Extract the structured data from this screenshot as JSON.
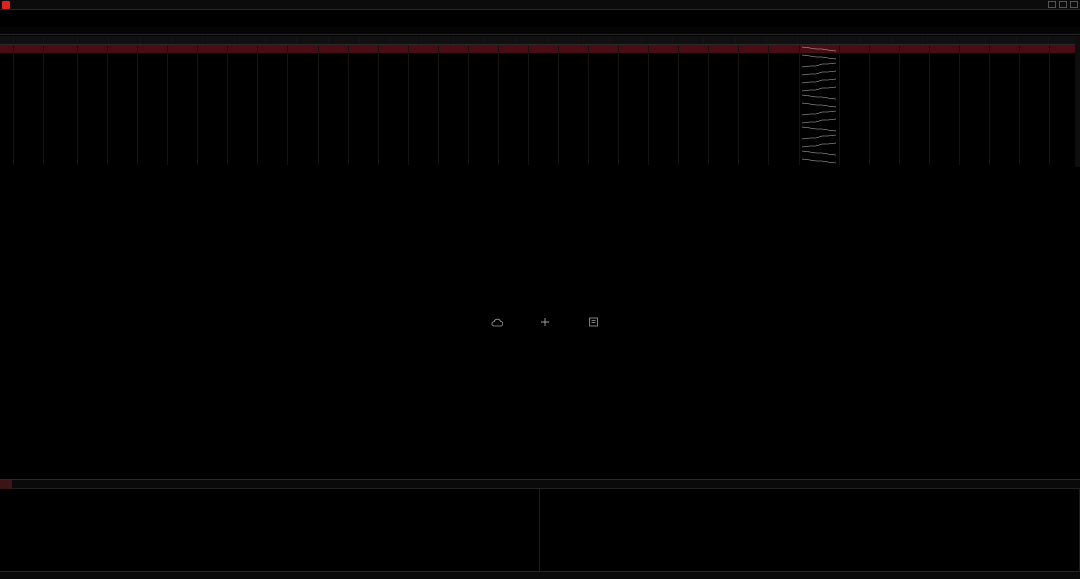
{
  "window": {
    "title": ""
  },
  "menus": {
    "top": [
      "",
      "",
      "",
      "",
      "",
      "",
      "",
      "",
      "",
      "",
      "",
      "",
      ""
    ],
    "function": [
      "",
      "",
      "",
      "",
      "",
      "",
      "",
      "",
      "",
      "",
      "",
      "",
      "",
      "",
      "",
      "",
      "",
      "",
      ""
    ],
    "quick": [
      "",
      "",
      "",
      "",
      "",
      "",
      "",
      "",
      "",
      "",
      "",
      "",
      "",
      "",
      "",
      "",
      "",
      "",
      "",
      ""
    ],
    "tabs": [
      "",
      "",
      "",
      "",
      "",
      "",
      "",
      "",
      "",
      "",
      "",
      "",
      "",
      "",
      "",
      "",
      "",
      "",
      ""
    ]
  },
  "table": {
    "headers": [
      "",
      "",
      "",
      "",
      "",
      "",
      "",
      "",
      "",
      "",
      "",
      "",
      "",
      "",
      "",
      "",
      "",
      "",
      "",
      "",
      "",
      "",
      "",
      "",
      "",
      "",
      "",
      "",
      "",
      "",
      "",
      "",
      "",
      "",
      ""
    ],
    "selected_row": 0,
    "rows": [
      {
        "idx": "",
        "code": "",
        "name": "",
        "dir": "down",
        "cells": [
          "",
          "",
          "",
          "",
          "",
          "",
          "",
          "",
          "",
          "",
          "",
          "",
          "",
          "",
          "",
          "",
          "",
          "",
          "",
          "",
          "",
          "",
          "",
          "",
          "",
          "",
          "",
          "",
          "",
          "",
          "",
          ""
        ]
      },
      {
        "idx": "",
        "code": "",
        "name": "",
        "dir": "down",
        "cells": [
          "",
          "",
          "",
          "",
          "",
          "",
          "",
          "",
          "",
          "",
          "",
          "",
          "",
          "",
          "",
          "",
          "",
          "",
          "",
          "",
          "",
          "",
          "",
          "",
          "",
          "",
          "",
          "",
          "",
          "",
          "",
          ""
        ]
      },
      {
        "idx": "",
        "code": "",
        "name": "",
        "dir": "up",
        "cells": [
          "",
          "",
          "",
          "",
          "",
          "",
          "",
          "",
          "",
          "",
          "",
          "",
          "",
          "",
          "",
          "",
          "",
          "",
          "",
          "",
          "",
          "",
          "",
          "",
          "",
          "",
          "",
          "",
          "",
          "",
          "",
          ""
        ]
      },
      {
        "idx": "",
        "code": "",
        "name": "",
        "dir": "up",
        "cells": [
          "",
          "",
          "",
          "",
          "",
          "",
          "",
          "",
          "",
          "",
          "",
          "",
          "",
          "",
          "",
          "",
          "",
          "",
          "",
          "",
          "",
          "",
          "",
          "",
          "",
          "",
          "",
          "",
          "",
          "",
          "",
          ""
        ]
      },
      {
        "idx": "",
        "code": "",
        "name": "",
        "dir": "up",
        "cells": [
          "",
          "",
          "",
          "",
          "",
          "",
          "",
          "",
          "",
          "",
          "",
          "",
          "",
          "",
          "",
          "",
          "",
          "",
          "",
          "",
          "",
          "",
          "",
          "",
          "",
          "",
          "",
          "",
          "",
          "",
          "",
          ""
        ]
      },
      {
        "idx": "",
        "code": "",
        "name": "",
        "dir": "up",
        "cells": [
          "",
          "",
          "",
          "",
          "",
          "",
          "",
          "",
          "",
          "",
          "",
          "",
          "",
          "",
          "",
          "",
          "",
          "",
          "",
          "",
          "",
          "",
          "",
          "",
          "",
          "",
          "",
          "",
          "",
          "",
          "",
          ""
        ]
      },
      {
        "idx": "",
        "code": "",
        "name": "",
        "dir": "down",
        "cells": [
          "",
          "",
          "",
          "",
          "",
          "",
          "",
          "",
          "",
          "",
          "",
          "",
          "",
          "",
          "",
          "",
          "",
          "",
          "",
          "",
          "",
          "",
          "",
          "",
          "",
          "",
          "",
          "",
          "",
          "",
          "",
          ""
        ]
      },
      {
        "idx": "",
        "code": "",
        "name": "",
        "dir": "down",
        "cells": [
          "",
          "",
          "",
          "",
          "",
          "",
          "",
          "",
          "",
          "",
          "",
          "",
          "",
          "",
          "",
          "",
          "",
          "",
          "",
          "",
          "",
          "",
          "",
          "",
          "",
          "",
          "",
          "",
          "",
          "",
          "",
          ""
        ]
      },
      {
        "idx": "",
        "code": "",
        "name": "",
        "dir": "up",
        "cells": [
          "",
          "",
          "",
          "",
          "",
          "",
          "",
          "",
          "",
          "",
          "",
          "",
          "",
          "",
          "",
          "",
          "",
          "",
          "",
          "",
          "",
          "",
          "",
          "",
          "",
          "",
          "",
          "",
          "",
          "",
          "",
          ""
        ]
      },
      {
        "idx": "",
        "code": "",
        "name": "",
        "dir": "up",
        "cells": [
          "",
          "",
          "",
          "",
          "",
          "",
          "",
          "",
          "",
          "",
          "",
          "",
          "",
          "",
          "",
          "",
          "",
          "",
          "",
          "",
          "",
          "",
          "",
          "",
          "",
          "",
          "",
          "",
          "",
          "",
          "",
          ""
        ]
      },
      {
        "idx": "",
        "code": "",
        "name": "",
        "dir": "down",
        "cells": [
          "",
          "",
          "",
          "",
          "",
          "",
          "",
          "",
          "",
          "",
          "",
          "",
          "",
          "",
          "",
          "",
          "",
          "",
          "",
          "",
          "",
          "",
          "",
          "",
          "",
          "",
          "",
          "",
          "",
          "",
          "",
          ""
        ]
      },
      {
        "idx": "",
        "code": "",
        "name": "",
        "dir": "up",
        "cells": [
          "",
          "",
          "",
          "",
          "",
          "",
          "",
          "",
          "",
          "",
          "",
          "",
          "",
          "",
          "",
          "",
          "",
          "",
          "",
          "",
          "",
          "",
          "",
          "",
          "",
          "",
          "",
          "",
          "",
          "",
          "",
          ""
        ]
      },
      {
        "idx": "",
        "code": "",
        "name": "",
        "dir": "up",
        "cells": [
          "",
          "",
          "",
          "",
          "",
          "",
          "",
          "",
          "",
          "",
          "",
          "",
          "",
          "",
          "",
          "",
          "",
          "",
          "",
          "",
          "",
          "",
          "",
          "",
          "",
          "",
          "",
          "",
          "",
          "",
          "",
          ""
        ]
      },
      {
        "idx": "",
        "code": "",
        "name": "",
        "dir": "down",
        "cells": [
          "",
          "",
          "",
          "",
          "",
          "",
          "",
          "",
          "",
          "",
          "",
          "",
          "",
          "",
          "",
          "",
          "",
          "",
          "",
          "",
          "",
          "",
          "",
          "",
          "",
          "",
          "",
          "",
          "",
          "",
          "",
          ""
        ]
      },
      {
        "idx": "",
        "code": "",
        "name": "",
        "dir": "down",
        "cells": [
          "",
          "",
          "",
          "",
          "",
          "",
          "",
          "",
          "",
          "",
          "",
          "",
          "",
          "",
          "",
          "",
          "",
          "",
          "",
          "",
          "",
          "",
          "",
          "",
          "",
          "",
          "",
          "",
          "",
          "",
          "",
          ""
        ]
      }
    ]
  },
  "empty_actions": [
    {
      "name": "cloud-sync",
      "icon": "cloud-icon",
      "label": ""
    },
    {
      "name": "add",
      "icon": "plus-icon",
      "label": ""
    },
    {
      "name": "help",
      "icon": "book-icon",
      "label": ""
    }
  ],
  "news": {
    "tabs": [
      "",
      "",
      "",
      ""
    ],
    "active_tab": 0,
    "left": [
      {
        "text": "",
        "time": ""
      },
      {
        "text": "",
        "time": ""
      },
      {
        "text": "",
        "time": ""
      },
      {
        "text": "",
        "time": ""
      },
      {
        "text": "",
        "time": ""
      },
      {
        "text": "",
        "time": ""
      },
      {
        "text": "",
        "time": ""
      },
      {
        "text": "",
        "time": ""
      },
      {
        "text": "",
        "time": ""
      },
      {
        "text": "",
        "time": ""
      }
    ],
    "right": [
      {
        "text": "",
        "time": ""
      },
      {
        "text": "",
        "time": ""
      },
      {
        "text": "",
        "time": ""
      },
      {
        "text": "",
        "time": ""
      },
      {
        "text": "",
        "time": ""
      },
      {
        "text": "",
        "time": ""
      },
      {
        "text": "",
        "time": ""
      },
      {
        "text": "",
        "time": ""
      },
      {
        "text": "",
        "time": ""
      },
      {
        "text": "",
        "time": ""
      }
    ]
  },
  "status": {
    "text": ""
  },
  "colors": {
    "up": "#ff4040",
    "down": "#1fc24a",
    "accent": "#e8c74a",
    "selected_row": "#4a0d14"
  }
}
